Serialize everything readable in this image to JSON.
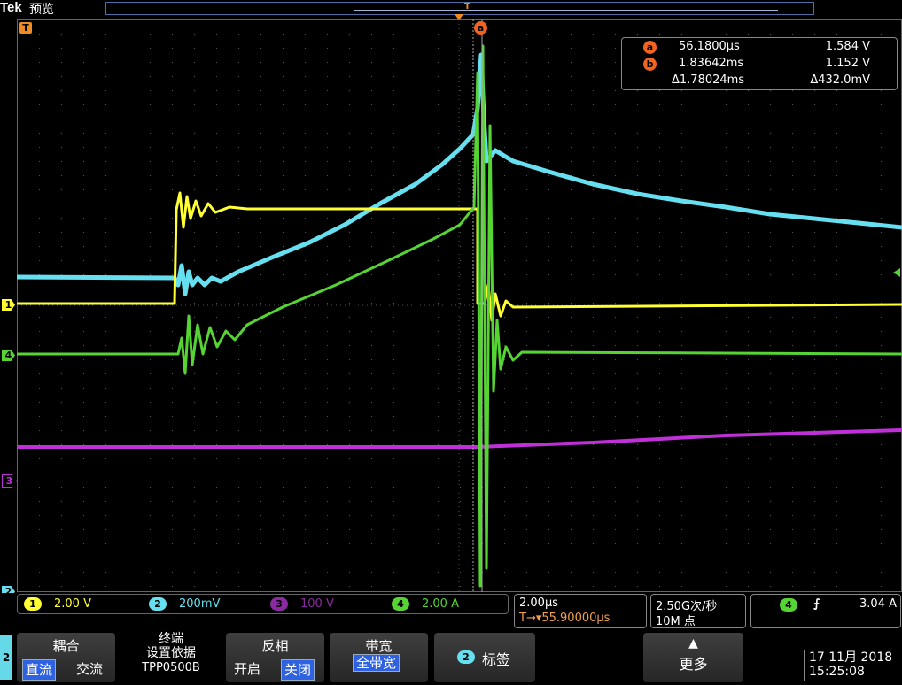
{
  "header": {
    "logo": "Tek",
    "mode": "预览"
  },
  "record_marker": "T",
  "trigger_marker": "T",
  "cursor_markers": {
    "a": "a",
    "b": "b"
  },
  "cursors": [
    {
      "id": "a",
      "time": "56.1800µs",
      "value": "1.584 V"
    },
    {
      "id": "b",
      "time": "1.83642ms",
      "value": "1.152 V"
    }
  ],
  "delta": {
    "time": "Δ1.78024ms",
    "value": "Δ432.0mV"
  },
  "channel_markers": {
    "ch1": "1",
    "ch4": "4",
    "ch3": "3",
    "ch2": "2",
    "side": "2"
  },
  "channels": [
    {
      "num": "1",
      "scale": "2.00 V",
      "color": "#ffff33"
    },
    {
      "num": "2",
      "scale": "200mV",
      "color": "#66e0f0"
    },
    {
      "num": "3",
      "scale": "100 V",
      "color": "#a030c0"
    },
    {
      "num": "4",
      "scale": "2.00 A",
      "color": "#55d433"
    }
  ],
  "timebase": {
    "scale": "2.00µs",
    "position": "T→▾55.90000µs"
  },
  "acquisition": {
    "rate": "2.50G次/秒",
    "points": "10M 点"
  },
  "trigger": {
    "source": "4",
    "slope": "⨍",
    "level": "3.04 A"
  },
  "softkeys": {
    "coupling": {
      "title": "耦合",
      "opt1": "直流",
      "opt2": "交流"
    },
    "termination": {
      "line1": "终端",
      "line2": "设置依据",
      "line3": "TPP0500B"
    },
    "invert": {
      "title": "反相",
      "opt1": "开启",
      "opt2": "关闭"
    },
    "bandwidth": {
      "title": "带宽",
      "opt1": "全带宽"
    },
    "label": {
      "num": "2",
      "title": "标签"
    },
    "more": {
      "arrow": "▲",
      "title": "更多"
    }
  },
  "datetime": {
    "date": "17 11月 2018",
    "time": "15:25:08"
  },
  "colors": {
    "ch1": "#ffff33",
    "ch2": "#66e0f0",
    "ch3": "#c030d8",
    "ch4": "#55d433",
    "accent": "#f2641e"
  }
}
